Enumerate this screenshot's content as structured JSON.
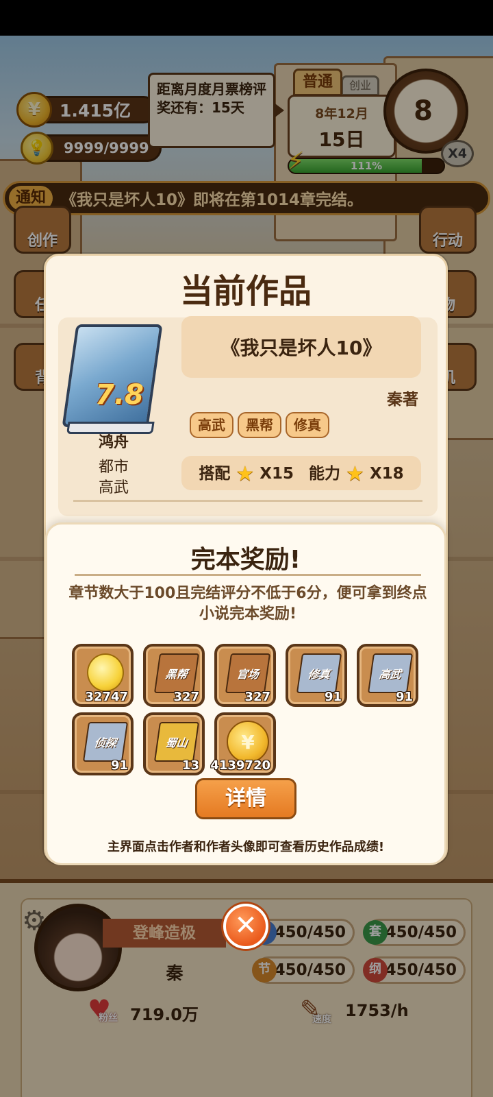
{
  "hud": {
    "coins": "1.415亿",
    "coin_symbol": "¥",
    "inspiration": "9999/9999",
    "tooltip": "距离月度月票榜评奖还有：15天",
    "mode": "普通",
    "mode_alt": "创业",
    "date_month": "8年12月",
    "date_day": "15日",
    "clock_value": "8",
    "speed_multiplier": "X4",
    "energy_text": "111%",
    "energy_fill": 0.86
  },
  "notice": {
    "tag": "通知",
    "text": "《我只是坏人10》即将在第1014章完结。"
  },
  "side_buttons": {
    "create": "创作",
    "task": "任",
    "bag": "背",
    "action": "行动",
    "goods": "物",
    "phone": "机"
  },
  "dialog": {
    "title": "当前作品",
    "book_score": "7.8",
    "author_name": "鸿舟",
    "genre_main": "都市",
    "genre_sub": "高武",
    "book_title": "《我只是坏人10》",
    "author_sign": "秦著",
    "tags": [
      "高武",
      "黑帮",
      "修真"
    ],
    "match_label": "搭配",
    "match_value": "X15",
    "ability_label": "能力",
    "ability_value": "X18"
  },
  "reward": {
    "title": "完本奖励!",
    "description": "章节数大于100且完结评分不低于6分，便可拿到终点小说完本奖励!",
    "items": [
      {
        "kind": "inspiration",
        "label": "",
        "count": "32747"
      },
      {
        "kind": "book",
        "label": "黑帮",
        "count": "327",
        "color": "#b8743c"
      },
      {
        "kind": "book",
        "label": "官场",
        "count": "327",
        "color": "#b8743c"
      },
      {
        "kind": "book",
        "label": "修真",
        "count": "91",
        "color": "#a9b9cf"
      },
      {
        "kind": "book",
        "label": "高武",
        "count": "91",
        "color": "#a9b9cf"
      },
      {
        "kind": "book",
        "label": "侦探",
        "count": "91",
        "color": "#a9b9cf"
      },
      {
        "kind": "book",
        "label": "蜀山",
        "count": "13",
        "color": "#e8b93c"
      },
      {
        "kind": "coin",
        "label": "",
        "count": "4139720"
      }
    ],
    "detail_button": "详情",
    "hint": "主界面点击作者和作者头像即可查看历史作品成绩!"
  },
  "profile": {
    "title": "登峰造极",
    "name": "秦",
    "close_symbol": "✕",
    "stats": [
      {
        "badge": "",
        "value": "450/450",
        "color": "#4a7fd0"
      },
      {
        "badge": "套",
        "value": "450/450",
        "color": "#3a9a4a"
      },
      {
        "badge": "节",
        "value": "450/450",
        "color": "#d98a2a"
      },
      {
        "badge": "纲",
        "value": "450/450",
        "color": "#d04a3a"
      }
    ],
    "fans_label": "粉丝",
    "fans_value": "719.0万",
    "speed_label": "速度",
    "speed_value": "1753/h"
  }
}
